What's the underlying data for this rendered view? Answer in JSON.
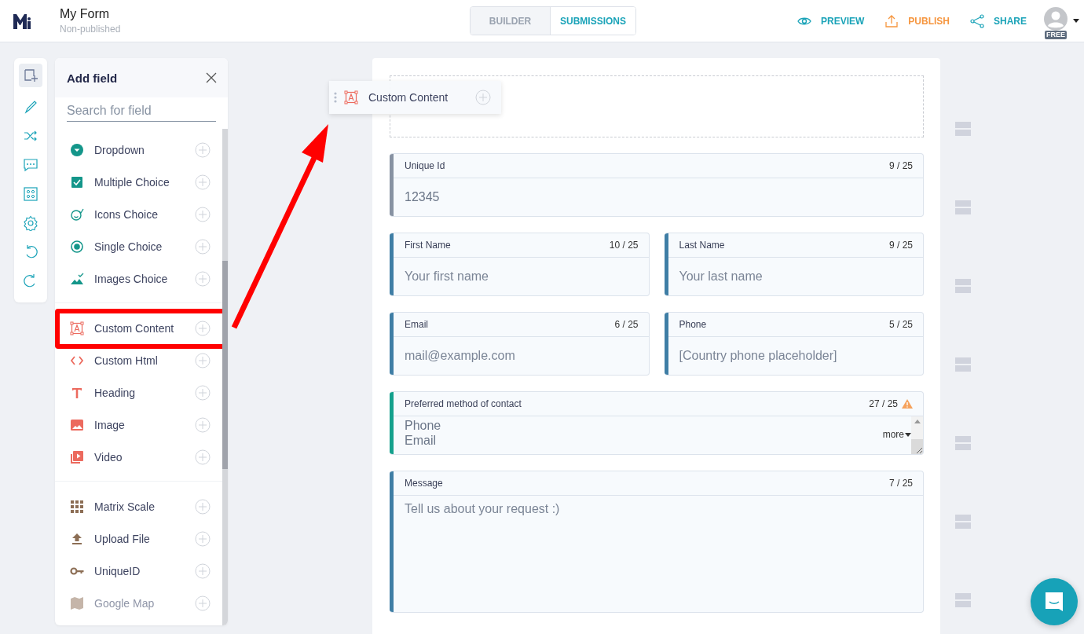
{
  "header": {
    "title": "My Form",
    "subtitle": "Non-published",
    "tabs": [
      {
        "label": "BUILDER",
        "selected": true
      },
      {
        "label": "SUBMISSIONS",
        "selected": false
      }
    ],
    "actions": [
      {
        "label": "PREVIEW",
        "kind": "preview"
      },
      {
        "label": "PUBLISH",
        "kind": "publish"
      },
      {
        "label": "SHARE",
        "kind": "share"
      }
    ],
    "plan_badge": "FREE"
  },
  "tool_rail": [
    {
      "selected": true
    },
    {
      "selected": false
    },
    {
      "selected": false
    },
    {
      "selected": false
    },
    {
      "selected": false
    },
    {
      "selected": false
    },
    {
      "selected": false
    },
    {
      "selected": false
    }
  ],
  "add_field_panel": {
    "title": "Add field",
    "search": {
      "placeholder": "Search for field"
    },
    "groups": [
      {
        "items": [
          {
            "label": "Dropdown",
            "highlighted": false
          },
          {
            "label": "Multiple Choice",
            "highlighted": false
          },
          {
            "label": "Icons Choice",
            "highlighted": false
          },
          {
            "label": "Single Choice",
            "highlighted": false
          },
          {
            "label": "Images Choice",
            "highlighted": false
          }
        ]
      },
      {
        "items": [
          {
            "label": "Custom Content",
            "highlighted": true
          },
          {
            "label": "Custom Html",
            "highlighted": false
          },
          {
            "label": "Heading",
            "highlighted": false
          },
          {
            "label": "Image",
            "highlighted": false
          },
          {
            "label": "Video",
            "highlighted": false
          }
        ]
      },
      {
        "items": [
          {
            "label": "Matrix Scale",
            "highlighted": false
          },
          {
            "label": "Upload File",
            "highlighted": false
          },
          {
            "label": "UniqueID",
            "highlighted": false
          },
          {
            "label": "Google Map",
            "highlighted": false
          }
        ]
      }
    ]
  },
  "drag_ghost": {
    "label": "Custom Content"
  },
  "form": {
    "rows": [
      {
        "fields": [
          {
            "kind": "text",
            "label": "Unique Id",
            "count": "9 / 25",
            "value": "12345",
            "color": "#8792a2",
            "warning": false
          }
        ]
      },
      {
        "fields": [
          {
            "kind": "text",
            "label": "First Name",
            "count": "10 / 25",
            "placeholder": "Your first name",
            "color": "#3f7ea5",
            "warning": false
          },
          {
            "kind": "text",
            "label": "Last Name",
            "count": "9 / 25",
            "placeholder": "Your last name",
            "color": "#3f7ea5",
            "warning": false
          }
        ]
      },
      {
        "fields": [
          {
            "kind": "text",
            "label": "Email",
            "count": "6 / 25",
            "placeholder": "mail@example.com",
            "color": "#3f7ea5",
            "warning": false
          },
          {
            "kind": "text",
            "label": "Phone",
            "count": "5 / 25",
            "placeholder": "[Country phone placeholder]",
            "color": "#3f7ea5",
            "warning": false
          }
        ]
      },
      {
        "fields": [
          {
            "kind": "select",
            "label": "Preferred method of contact",
            "count": "27 / 25",
            "options": [
              "Phone",
              "Email"
            ],
            "more": "more",
            "color": "#14a08c",
            "warning": true
          }
        ]
      },
      {
        "fields": [
          {
            "kind": "textarea",
            "label": "Message",
            "count": "7 / 25",
            "placeholder": "Tell us about your request :)",
            "color": "#3f7ea5",
            "warning": false
          }
        ]
      }
    ]
  }
}
